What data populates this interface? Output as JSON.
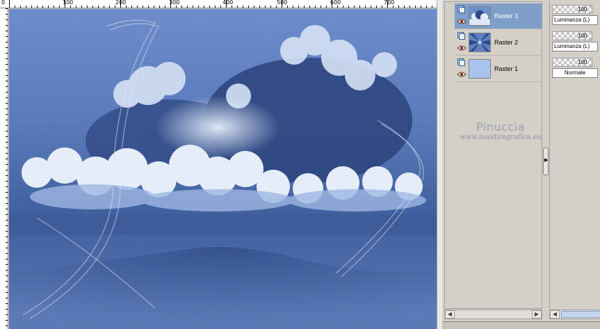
{
  "ruler": {
    "labels": [
      "0",
      "100",
      "200",
      "300",
      "400",
      "500",
      "600",
      "700"
    ]
  },
  "canvas": {
    "description_icon": "sky-clouds-image",
    "palette": {
      "sky_dark": "#2e4a86",
      "sky_mid": "#5f80bd",
      "sky_light": "#9fb8e4",
      "cloud": "#e6eefa"
    }
  },
  "layers": [
    {
      "name": "Raster 3",
      "active": true,
      "thumb": "clouds"
    },
    {
      "name": "Raster 2",
      "active": false,
      "thumb": "rays"
    },
    {
      "name": "Raster 1",
      "active": false,
      "thumb": "solid"
    }
  ],
  "properties": [
    {
      "opacity": "100",
      "blend_mode": "Luminanza (L)"
    },
    {
      "opacity": "100",
      "blend_mode": "Luminanza (L)"
    },
    {
      "opacity": "100",
      "blend_mode": "Normale"
    }
  ],
  "watermark": {
    "name": "Pinuccia",
    "url": "www.maidiregrafica.eu"
  },
  "colors": {
    "layer_selected": "#7f9fc8",
    "panel_bg": "#d4d0c8",
    "raster1_fill": "#a9c3f0"
  }
}
